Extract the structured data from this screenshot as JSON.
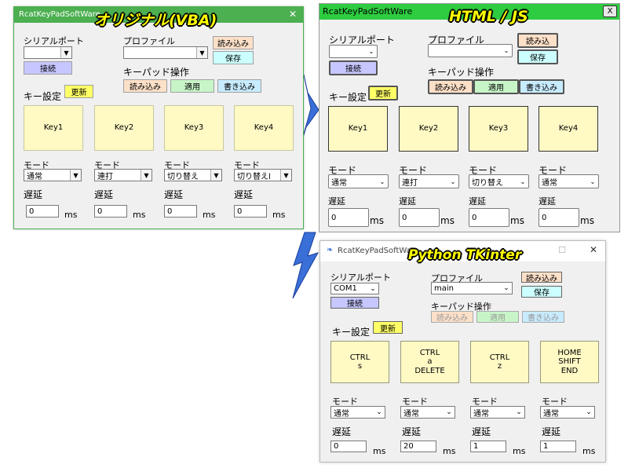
{
  "colors": {
    "accent_green": "#4caf50",
    "key_fill": "#fff9c4",
    "connect_fill": "#c7c7ff",
    "read_fill": "#fde0c8",
    "save_fill": "#ccffff",
    "apply_fill": "#c8f5c8",
    "write_fill": "#c8ecff",
    "update_fill": "#ffff66",
    "arrow_fill": "#3a6fd8"
  },
  "vba": {
    "window_title": "RcatKeyPadSoftWare",
    "overlay_title": "オリジナル(VBA)",
    "close_glyph": "✕",
    "serial_label": "シリアルポート",
    "serial_value": "",
    "connect_label": "接続",
    "profile_label": "プロファイル",
    "profile_value": "",
    "load_label": "読み込み",
    "save_label": "保存",
    "keypad_ops_label": "キーパッド操作",
    "op_read": "読み込み",
    "op_apply": "適用",
    "op_write": "書き込み",
    "key_settings_label": "キー設定",
    "update_label": "更新",
    "keys": [
      "Key1",
      "Key2",
      "Key3",
      "Key4"
    ],
    "mode_label": "モード",
    "modes": [
      "通常",
      "連打",
      "切り替え",
      "切り替えl"
    ],
    "delay_label": "遅延",
    "delays": [
      "0",
      "0",
      "0",
      "0"
    ],
    "unit": "ms"
  },
  "html": {
    "window_title": "RcatKeyPadSoftWare",
    "overlay_title": "HTML / JS",
    "close_glyph": "X",
    "serial_label": "シリアルポート",
    "serial_value": "",
    "connect_label": "接続",
    "profile_label": "プロファイル",
    "profile_value": "",
    "load_label": "読み込",
    "save_label": "保存",
    "keypad_ops_label": "キーパッド操作",
    "op_read": "読み込み",
    "op_apply": "適用",
    "op_write": "書き込み",
    "key_settings_label": "キー設定",
    "update_label": "更新",
    "keys": [
      "Key1",
      "Key2",
      "Key3",
      "Key4"
    ],
    "mode_label": "モード",
    "modes": [
      "通常",
      "連打",
      "切り替え",
      "通常"
    ],
    "delay_label": "遅延",
    "delays": [
      "0",
      "0",
      "0",
      "0"
    ],
    "unit": "ms"
  },
  "tk": {
    "window_title": "RcatKeyPadSoftWare",
    "overlay_title": "Python TKinter",
    "close_glyph": "✕",
    "maximize_glyph": "☐",
    "serial_label": "シリアルポート",
    "serial_value": "COM1",
    "connect_label": "接続",
    "profile_label": "プロファイル",
    "profile_value": "main",
    "load_label": "読み込み",
    "save_label": "保存",
    "keypad_ops_label": "キーパッド操作",
    "op_read": "読み込み",
    "op_apply": "適用",
    "op_write": "書き込み",
    "key_settings_label": "キー設定",
    "update_label": "更新",
    "keys": [
      "CTRL\ns",
      "CTRL\na\nDELETE",
      "CTRL\nz",
      "HOME\nSHIFT\nEND"
    ],
    "mode_label": "モード",
    "modes": [
      "通常",
      "通常",
      "通常",
      "通常"
    ],
    "delay_label": "遅延",
    "delays": [
      "0",
      "20",
      "1",
      "1"
    ],
    "unit": "ms"
  }
}
